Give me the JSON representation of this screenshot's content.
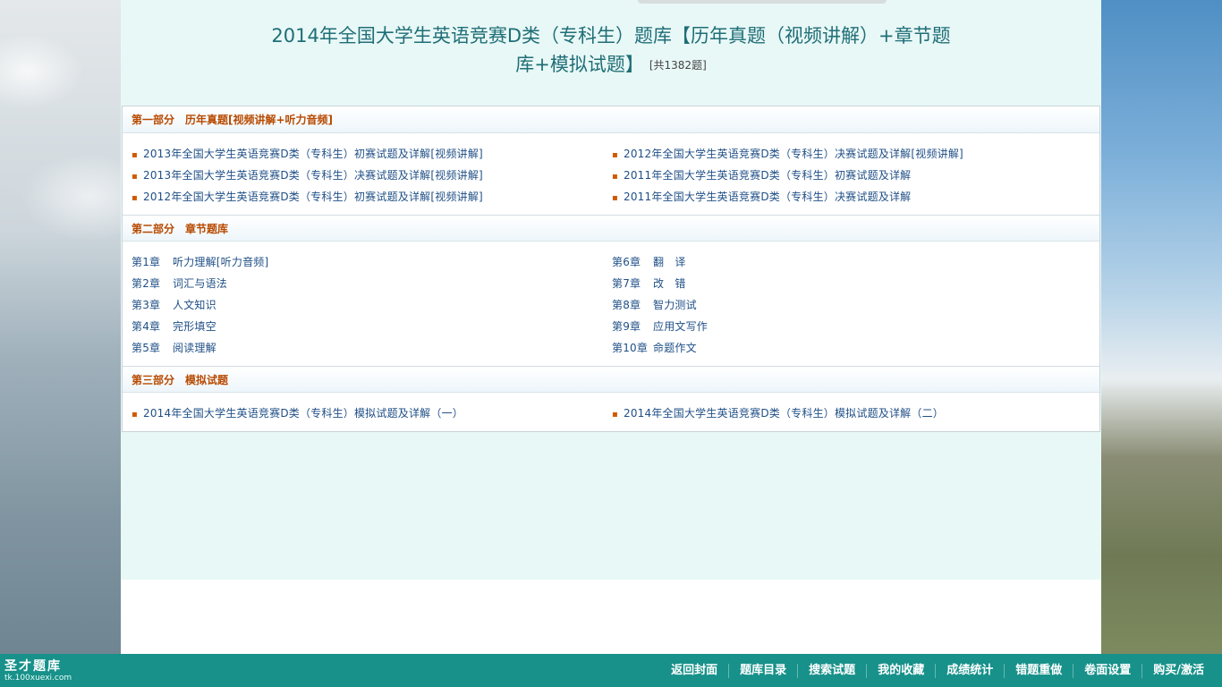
{
  "title": {
    "line1": "2014年全国大学生英语竞赛D类（专科生）题库【历年真题（视频讲解）+章节题",
    "line2": "库+模拟试题】",
    "count": "[共1382题]"
  },
  "sections": [
    {
      "heading": "第一部分　历年真题[视频讲解+听力音频]",
      "items": [
        "2013年全国大学生英语竞赛D类（专科生）初赛试题及详解[视频讲解]",
        "2012年全国大学生英语竞赛D类（专科生）决赛试题及详解[视频讲解]",
        "2013年全国大学生英语竞赛D类（专科生）决赛试题及详解[视频讲解]",
        "2011年全国大学生英语竞赛D类（专科生）初赛试题及详解",
        "2012年全国大学生英语竞赛D类（专科生）初赛试题及详解[视频讲解]",
        "2011年全国大学生英语竞赛D类（专科生）决赛试题及详解"
      ]
    },
    {
      "heading": "第二部分　章节题库",
      "chapters": [
        {
          "no": "第1章",
          "name": "听力理解[听力音频]"
        },
        {
          "no": "第6章",
          "name": "翻　译"
        },
        {
          "no": "第2章",
          "name": "词汇与语法"
        },
        {
          "no": "第7章",
          "name": "改　错"
        },
        {
          "no": "第3章",
          "name": "人文知识"
        },
        {
          "no": "第8章",
          "name": "智力测试"
        },
        {
          "no": "第4章",
          "name": "完形填空"
        },
        {
          "no": "第9章",
          "name": "应用文写作"
        },
        {
          "no": "第5章",
          "name": "阅读理解"
        },
        {
          "no": "第10章",
          "name": "命题作文"
        }
      ]
    },
    {
      "heading": "第三部分　模拟试题",
      "items": [
        "2014年全国大学生英语竞赛D类（专科生）模拟试题及详解（一）",
        "2014年全国大学生英语竞赛D类（专科生）模拟试题及详解（二）"
      ]
    }
  ],
  "footer": {
    "logo_name": "圣才题库",
    "logo_url": "tk.100xuexi.com",
    "nav": [
      "返回封面",
      "题库目录",
      "搜索试题",
      "我的收藏",
      "成绩统计",
      "错题重做",
      "卷面设置",
      "购买/激活"
    ]
  },
  "colors": {
    "accent": "#17918a",
    "title": "#1f6e77",
    "section_heading": "#b84a00",
    "link": "#1f4f86",
    "content_bg": "#e8f8f6"
  }
}
